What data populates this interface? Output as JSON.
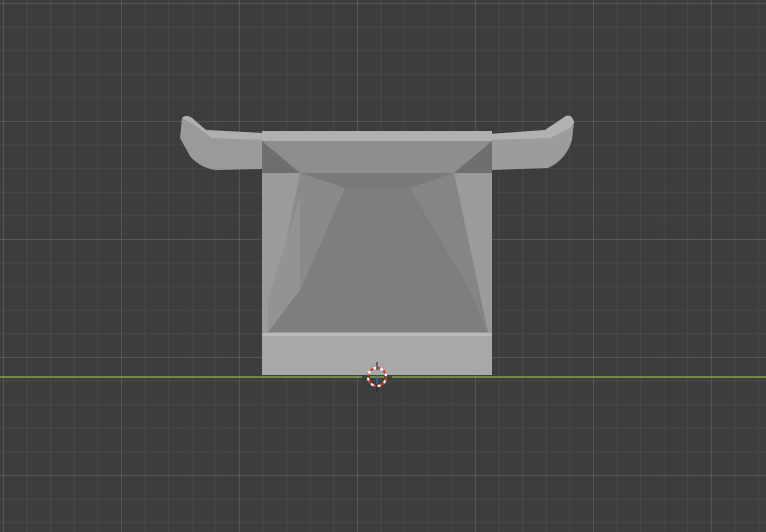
{
  "viewport": {
    "view": "front-orthographic",
    "colors": {
      "background": "#3d3d3d",
      "x_axis": "#7fa83c",
      "z_axis": "#2e6fb8",
      "mesh_light": "#aeaeae",
      "mesh_mid": "#8f8f8f",
      "mesh_dark": "#6e6e6e",
      "cursor_red": "#d8342c",
      "cursor_white": "#ffffff"
    },
    "icons": {
      "cursor": "3d-cursor-icon"
    }
  }
}
